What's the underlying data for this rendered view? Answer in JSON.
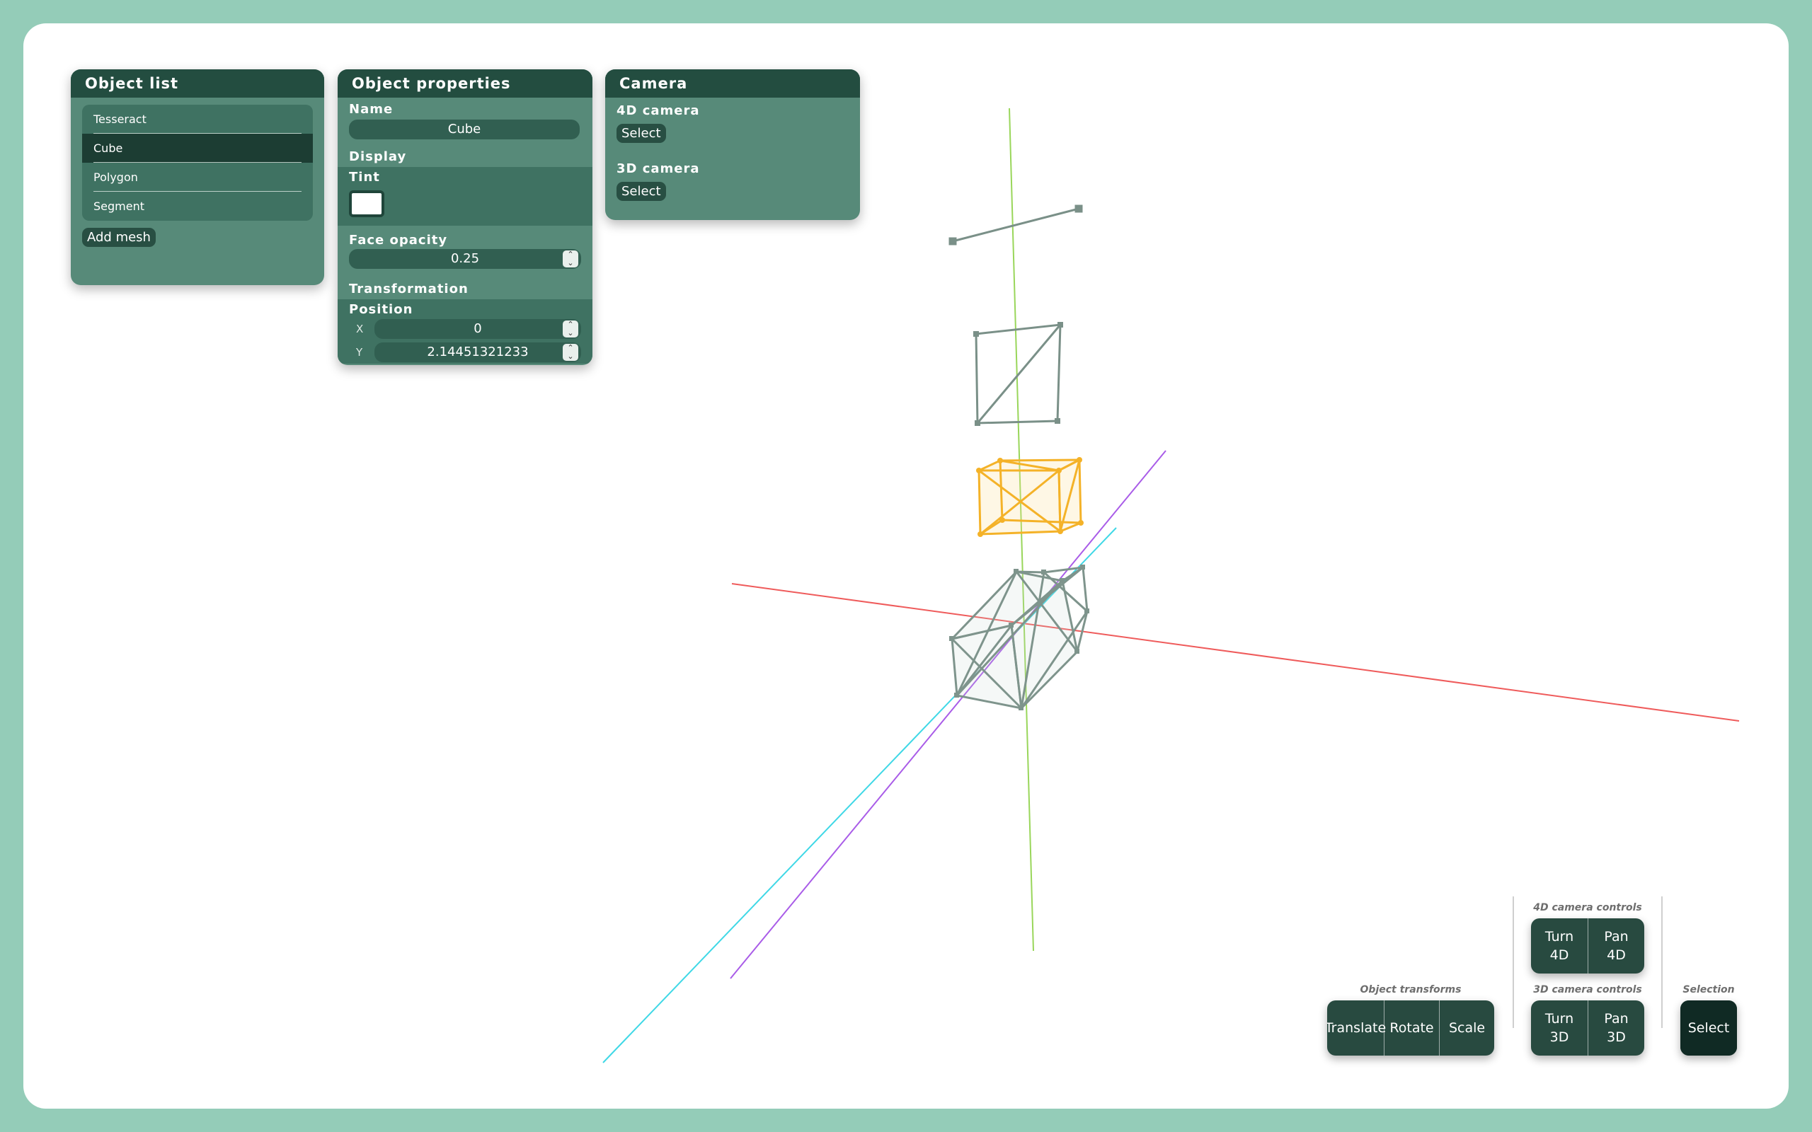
{
  "object_list": {
    "title": "Object list",
    "items": [
      {
        "label": "Tesseract"
      },
      {
        "label": "Cube"
      },
      {
        "label": "Polygon"
      },
      {
        "label": "Segment"
      }
    ],
    "selected_item": "Cube",
    "add_button": "Add mesh"
  },
  "object_properties": {
    "title": "Object properties",
    "name_label": "Name",
    "name_value": "Cube",
    "display_label": "Display",
    "tint_label": "Tint",
    "tint_color": "#ffffff",
    "face_opacity_label": "Face opacity",
    "face_opacity_value": "0.25",
    "transformation_label": "Transformation",
    "position_label": "Position",
    "x_label": "X",
    "x_value": "0",
    "y_label": "Y",
    "y_value": "2.14451321233"
  },
  "camera": {
    "title": "Camera",
    "cam4d_label": "4D camera",
    "cam4d_button": "Select",
    "cam3d_label": "3D camera",
    "cam3d_button": "Select"
  },
  "toolbar": {
    "cam4d_title": "4D camera controls",
    "turn4d": "Turn\n4D",
    "pan4d": "Pan\n4D",
    "cam3d_title": "3D camera controls",
    "turn3d": "Turn\n3D",
    "pan3d": "Pan\n3D",
    "transforms_title": "Object transforms",
    "translate": "Translate",
    "rotate": "Rotate",
    "scale": "Scale",
    "selection_title": "Selection",
    "select": "Select"
  },
  "colors": {
    "background": "#94ccb8",
    "panel": "#578a79",
    "panel_header": "#234d40",
    "axis_x": "#ef5b5b",
    "axis_y": "#99d65a",
    "axis_z": "#3fd8e6",
    "axis_w": "#a95ce8",
    "selected_mesh": "#f4b228",
    "mesh": "#7a9088"
  }
}
